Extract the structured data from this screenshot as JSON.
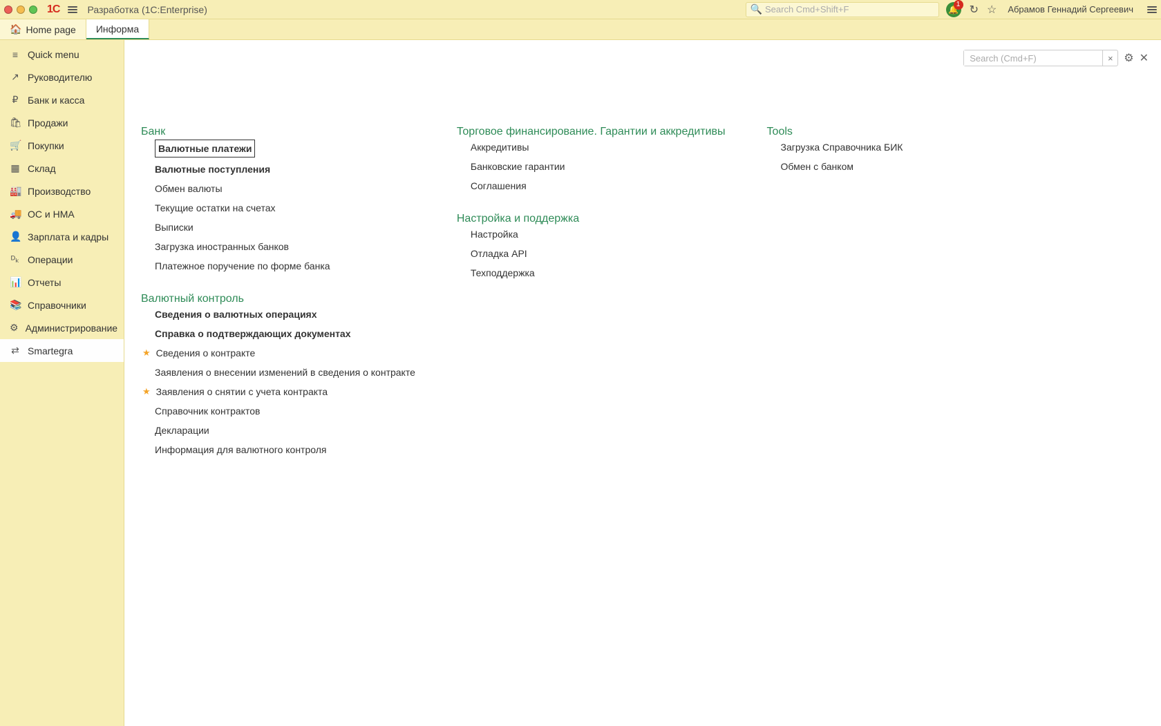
{
  "titlebar": {
    "title": "Разработка  (1C:Enterprise)",
    "logo_text": "1C",
    "search_placeholder": "Search Cmd+Shift+F",
    "bell_badge": "1",
    "user_name": "Абрамов Геннадий Сергеевич"
  },
  "tabs": {
    "home": "Home page",
    "second": "Информа"
  },
  "sidebar": [
    {
      "icon": "≡",
      "label": "Quick menu",
      "name": "quick-menu"
    },
    {
      "icon": "↗",
      "label": "Руководителю",
      "name": "manager"
    },
    {
      "icon": "₽",
      "label": "Банк и касса",
      "name": "bank-cash"
    },
    {
      "icon": "🛍",
      "label": "Продажи",
      "name": "sales"
    },
    {
      "icon": "🛒",
      "label": "Покупки",
      "name": "purchases"
    },
    {
      "icon": "▦",
      "label": "Склад",
      "name": "warehouse"
    },
    {
      "icon": "🏭",
      "label": "Производство",
      "name": "production"
    },
    {
      "icon": "🚚",
      "label": "ОС и НМА",
      "name": "assets"
    },
    {
      "icon": "👤",
      "label": "Зарплата и кадры",
      "name": "hr"
    },
    {
      "icon": "ᴰₖ",
      "label": "Операции",
      "name": "operations"
    },
    {
      "icon": "📊",
      "label": "Отчеты",
      "name": "reports"
    },
    {
      "icon": "📚",
      "label": "Справочники",
      "name": "catalogs"
    },
    {
      "icon": "⚙",
      "label": "Администрирование",
      "name": "admin"
    },
    {
      "icon": "⇄",
      "label": "Smartegra",
      "name": "smartegra",
      "selected": true
    }
  ],
  "main_toolbar": {
    "search_placeholder": "Search (Cmd+F)",
    "clear_label": "×"
  },
  "columns": [
    {
      "sections": [
        {
          "title": "Банк",
          "items": [
            {
              "label": "Валютные платежи",
              "bold": true,
              "highlight": true
            },
            {
              "label": "Валютные поступления",
              "bold": true
            },
            {
              "label": "Обмен валюты"
            },
            {
              "label": "Текущие остатки на счетах"
            },
            {
              "label": "Выписки"
            },
            {
              "label": "Загрузка иностранных банков"
            },
            {
              "label": "Платежное поручение по форме банка"
            }
          ]
        },
        {
          "title": "Валютный контроль",
          "items": [
            {
              "label": "Сведения о валютных операциях",
              "bold": true
            },
            {
              "label": "Справка о подтверждающих документах",
              "bold": true
            },
            {
              "label": "Сведения о контракте",
              "star": true
            },
            {
              "label": "Заявления о внесении изменений в сведения о контракте"
            },
            {
              "label": "Заявления о снятии с учета контракта",
              "star": true
            },
            {
              "label": "Справочник контрактов"
            },
            {
              "label": "Декларации"
            },
            {
              "label": "Информация для валютного контроля"
            }
          ]
        }
      ]
    },
    {
      "sections": [
        {
          "title": "Торговое финансирование. Гарантии и аккредитивы",
          "items": [
            {
              "label": "Аккредитивы"
            },
            {
              "label": "Банковские гарантии"
            },
            {
              "label": "Соглашения"
            }
          ]
        },
        {
          "title": "Настройка и поддержка",
          "items": [
            {
              "label": "Настройка"
            },
            {
              "label": "Отладка API"
            },
            {
              "label": "Техподдержка"
            }
          ]
        }
      ]
    },
    {
      "sections": [
        {
          "title": "Tools",
          "items": [
            {
              "label": "Загрузка Справочника БИК"
            },
            {
              "label": "Обмен с банком"
            }
          ]
        }
      ]
    }
  ]
}
